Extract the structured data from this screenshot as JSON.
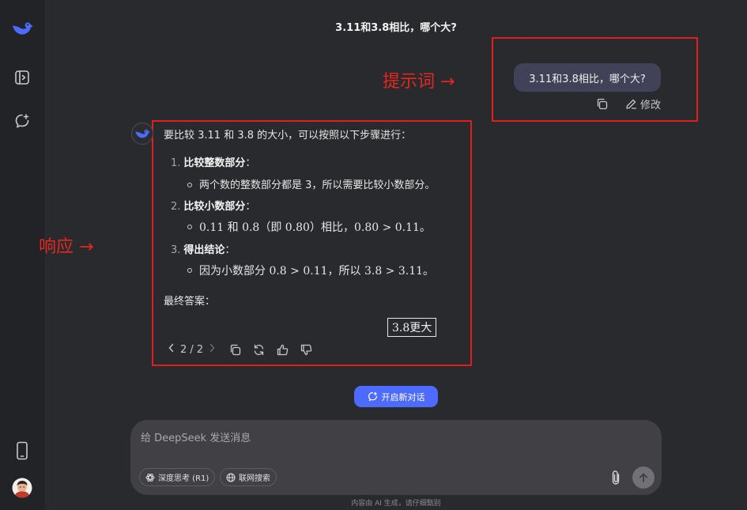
{
  "sidebar": {
    "icons": [
      "deepseek-logo-icon",
      "open-sidebar-icon",
      "new-chat-icon",
      "mobile-app-icon",
      "user-avatar"
    ]
  },
  "conversation": {
    "title": "3.11和3.8相比，哪个大?"
  },
  "user_message": {
    "text": "3.11和3.8相比，哪个大?",
    "edit_label": "修改"
  },
  "annotations": {
    "prompt_label": "提示词 →",
    "response_label": "响应 →",
    "color": "#e01e1e"
  },
  "response": {
    "intro": "要比较 3.11 和 3.8 的大小，可以按照以下步骤进行：",
    "steps": [
      {
        "num": "1.",
        "title": "比较整数部分",
        "colon": "：",
        "bullet": "两个数的整数部分都是 3，所以需要比较小数部分。"
      },
      {
        "num": "2.",
        "title": "比较小数部分",
        "colon": "：",
        "bullet": "0.11 和 0.8（即 0.80）相比，0.80 > 0.11。"
      },
      {
        "num": "3.",
        "title": "得出结论",
        "colon": "：",
        "bullet": "因为小数部分 0.8 > 0.11，所以 3.8 > 3.11。"
      }
    ],
    "final_label": "最终答案：",
    "final_answer": "3.8更大",
    "pager": "2 / 2"
  },
  "new_chat_button": {
    "label": "开启新对话"
  },
  "input": {
    "placeholder": "给 DeepSeek 发送消息",
    "deep_think_label": "深度思考 (R1)",
    "web_search_label": "联网搜索"
  },
  "footer": {
    "text": "内容由 AI 生成，请仔细甄别"
  },
  "colors": {
    "accent": "#4d6bfe",
    "background": "#292a2d",
    "sidebar": "#212327",
    "user_bubble": "#414158"
  }
}
